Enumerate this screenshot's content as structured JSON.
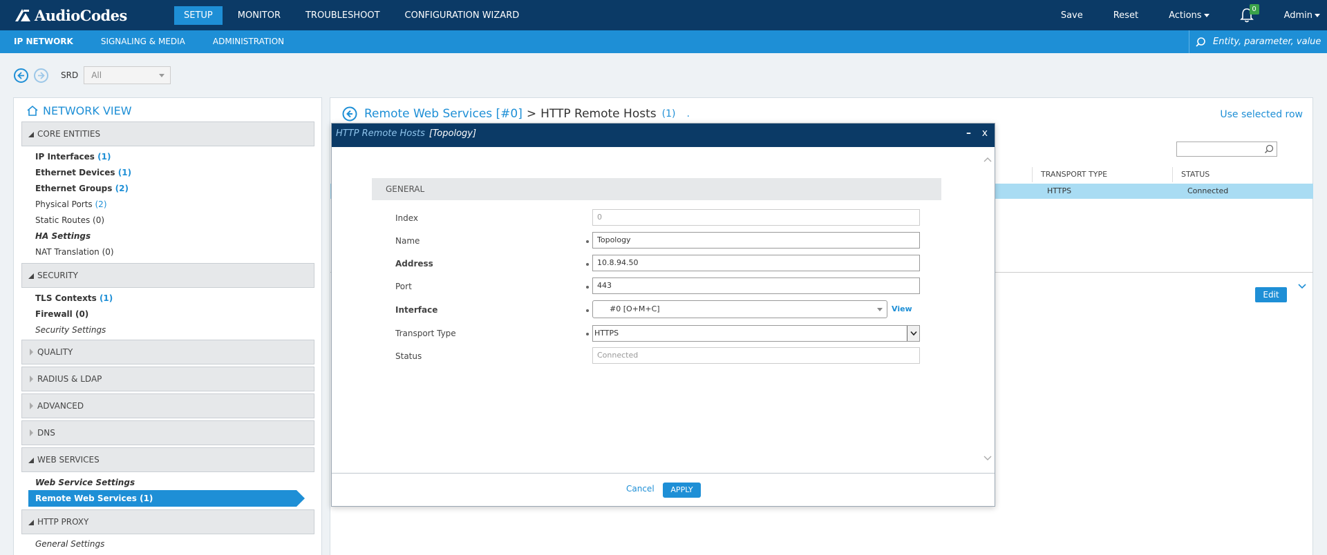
{
  "brand": {
    "name": "AudioCodes"
  },
  "topnav": {
    "items": [
      "SETUP",
      "MONITOR",
      "TROUBLESHOOT",
      "CONFIGURATION WIZARD"
    ],
    "save": "Save",
    "reset": "Reset",
    "actions": "Actions",
    "notifications": "0",
    "user": "Admin"
  },
  "subnav": {
    "items": [
      "IP NETWORK",
      "SIGNALING & MEDIA",
      "ADMINISTRATION"
    ],
    "search_placeholder": "Entity, parameter, value"
  },
  "srd": {
    "label": "SRD",
    "value": "All"
  },
  "network_view": {
    "title": "NETWORK VIEW",
    "sections": {
      "core": "CORE ENTITIES",
      "security": "SECURITY",
      "quality": "QUALITY",
      "radius": "RADIUS & LDAP",
      "advanced": "ADVANCED",
      "dns": "DNS",
      "web": "WEB SERVICES",
      "proxy": "HTTP PROXY"
    },
    "core_items": {
      "ip_interfaces": "IP Interfaces",
      "ip_interfaces_count": "(1)",
      "eth_devices": "Ethernet Devices",
      "eth_devices_count": "(1)",
      "eth_groups": "Ethernet Groups",
      "eth_groups_count": "(2)",
      "phys_ports": "Physical Ports",
      "phys_ports_count": "(2)",
      "static_routes": "Static Routes (0)",
      "ha_settings": "HA Settings",
      "nat": "NAT Translation (0)"
    },
    "security_items": {
      "tls": "TLS Contexts",
      "tls_count": "(1)",
      "firewall": "Firewall (0)",
      "sec_settings": "Security Settings"
    },
    "web_items": {
      "ws_settings": "Web Service Settings",
      "rws": "Remote Web Services (1)"
    },
    "proxy_items": {
      "general": "General Settings"
    }
  },
  "main": {
    "breadcrumb_link": "Remote Web Services [#0]",
    "breadcrumb_sep": ">",
    "breadcrumb_current": "HTTP Remote Hosts",
    "breadcrumb_count": "(1)",
    "breadcrumb_dot": ".",
    "use_selected": "Use selected row",
    "table": {
      "headers": [
        "TRANSPORT TYPE",
        "STATUS"
      ],
      "row": [
        "HTTPS",
        "Connected"
      ]
    },
    "edit": "Edit"
  },
  "modal": {
    "title": "HTTP Remote Hosts",
    "subtitle": "[Topology]",
    "minimize": "–",
    "close": "x",
    "section": "GENERAL",
    "fields": {
      "index_label": "Index",
      "index_value": "0",
      "name_label": "Name",
      "name_value": "Topology",
      "address_label": "Address",
      "address_value": "10.8.94.50",
      "port_label": "Port",
      "port_value": "443",
      "interface_label": "Interface",
      "interface_value": "#0 [O+M+C]",
      "interface_view": "View",
      "transport_label": "Transport Type",
      "transport_value": "HTTPS",
      "status_label": "Status",
      "status_value": "Connected"
    },
    "cancel": "Cancel",
    "apply": "APPLY"
  },
  "colors": {
    "navy": "#0b3a66",
    "accent": "#1e8fd6",
    "selected_row": "#a9dcf3"
  }
}
